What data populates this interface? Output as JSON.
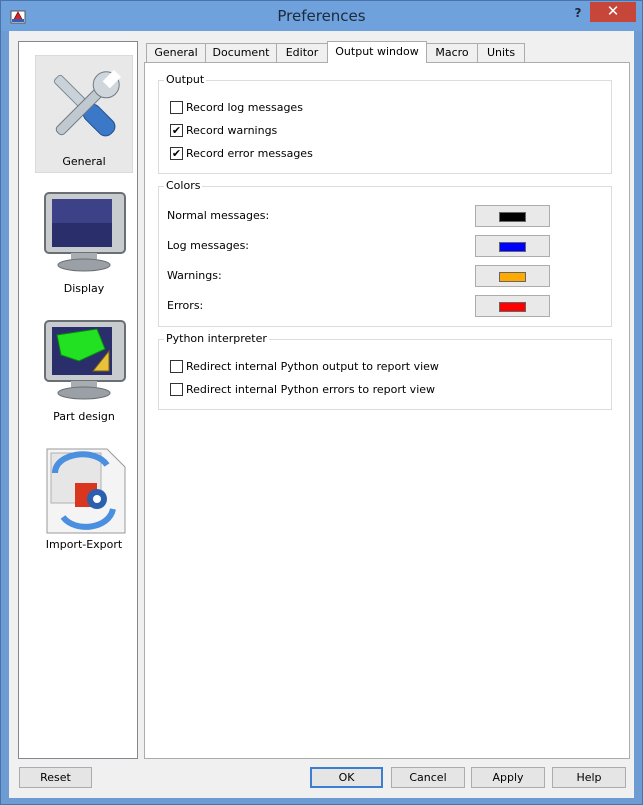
{
  "window": {
    "title": "Preferences",
    "help_label": "?",
    "close_label": "✕"
  },
  "sidebar": {
    "items": [
      {
        "label": "General",
        "icon": "wrench-screwdriver-icon",
        "selected": true
      },
      {
        "label": "Display",
        "icon": "monitor-icon",
        "selected": false
      },
      {
        "label": "Part design",
        "icon": "part-design-monitor-icon",
        "selected": false
      },
      {
        "label": "Import-Export",
        "icon": "import-export-icon",
        "selected": false
      }
    ]
  },
  "tabs": [
    {
      "label": "General",
      "active": false
    },
    {
      "label": "Document",
      "active": false
    },
    {
      "label": "Editor",
      "active": false
    },
    {
      "label": "Output window",
      "active": true
    },
    {
      "label": "Macro",
      "active": false
    },
    {
      "label": "Units",
      "active": false
    }
  ],
  "output": {
    "title": "Output",
    "options": [
      {
        "label": "Record log messages",
        "checked": false
      },
      {
        "label": "Record warnings",
        "checked": true
      },
      {
        "label": "Record error messages",
        "checked": true
      }
    ]
  },
  "colors": {
    "title": "Colors",
    "rows": [
      {
        "label": "Normal messages:",
        "color": "#000000"
      },
      {
        "label": "Log messages:",
        "color": "#0000ff"
      },
      {
        "label": "Warnings:",
        "color": "#ffaa00"
      },
      {
        "label": "Errors:",
        "color": "#ff0000"
      }
    ]
  },
  "python": {
    "title": "Python interpreter",
    "options": [
      {
        "label": "Redirect internal Python output to report view",
        "checked": false
      },
      {
        "label": "Redirect internal Python errors to report view",
        "checked": false
      }
    ]
  },
  "buttons": {
    "reset": "Reset",
    "ok": "OK",
    "cancel": "Cancel",
    "apply": "Apply",
    "help": "Help"
  },
  "check_mark": "✔"
}
